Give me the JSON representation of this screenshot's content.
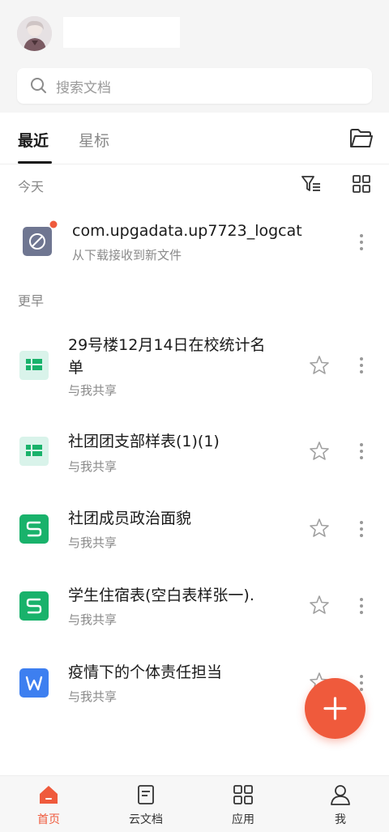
{
  "header": {
    "search_placeholder": "搜索文档"
  },
  "tabs": [
    {
      "label": "最近",
      "active": true
    },
    {
      "label": "星标",
      "active": false
    }
  ],
  "sections": {
    "today": "今天",
    "earlier": "更早"
  },
  "files": [
    {
      "title": "com.upgadata.up7723_logcat",
      "subtitle": "从下载接收到新文件",
      "icon": "download-file-icon",
      "unread": true
    },
    {
      "title_line1": "29号楼12月14日在校统计名",
      "title_line2": "单",
      "subtitle": "与我共享",
      "icon": "sheet-icon"
    },
    {
      "title": "社团团支部样表(1)(1)",
      "subtitle": "与我共享",
      "icon": "sheet-icon"
    },
    {
      "title": "社团成员政治面貌",
      "subtitle": "与我共享",
      "icon": "spreadsheet-s-icon"
    },
    {
      "title": "学生住宿表(空白表样张一).",
      "subtitle": "与我共享",
      "icon": "spreadsheet-s-icon"
    },
    {
      "title": "疫情下的个体责任担当",
      "subtitle": "与我共享",
      "icon": "word-doc-icon"
    }
  ],
  "bottom_nav": [
    {
      "label": "首页",
      "icon": "home-icon",
      "active": true
    },
    {
      "label": "云文档",
      "icon": "cloud-doc-icon",
      "active": false
    },
    {
      "label": "应用",
      "icon": "apps-grid-icon",
      "active": false
    },
    {
      "label": "我",
      "icon": "profile-icon",
      "active": false
    }
  ],
  "colors": {
    "accent": "#ef5a3c",
    "sheet_bg": "#d9f3ea",
    "sheet_green": "#19b26b",
    "s_green": "#19b26b",
    "word_blue": "#3d7ff0"
  }
}
